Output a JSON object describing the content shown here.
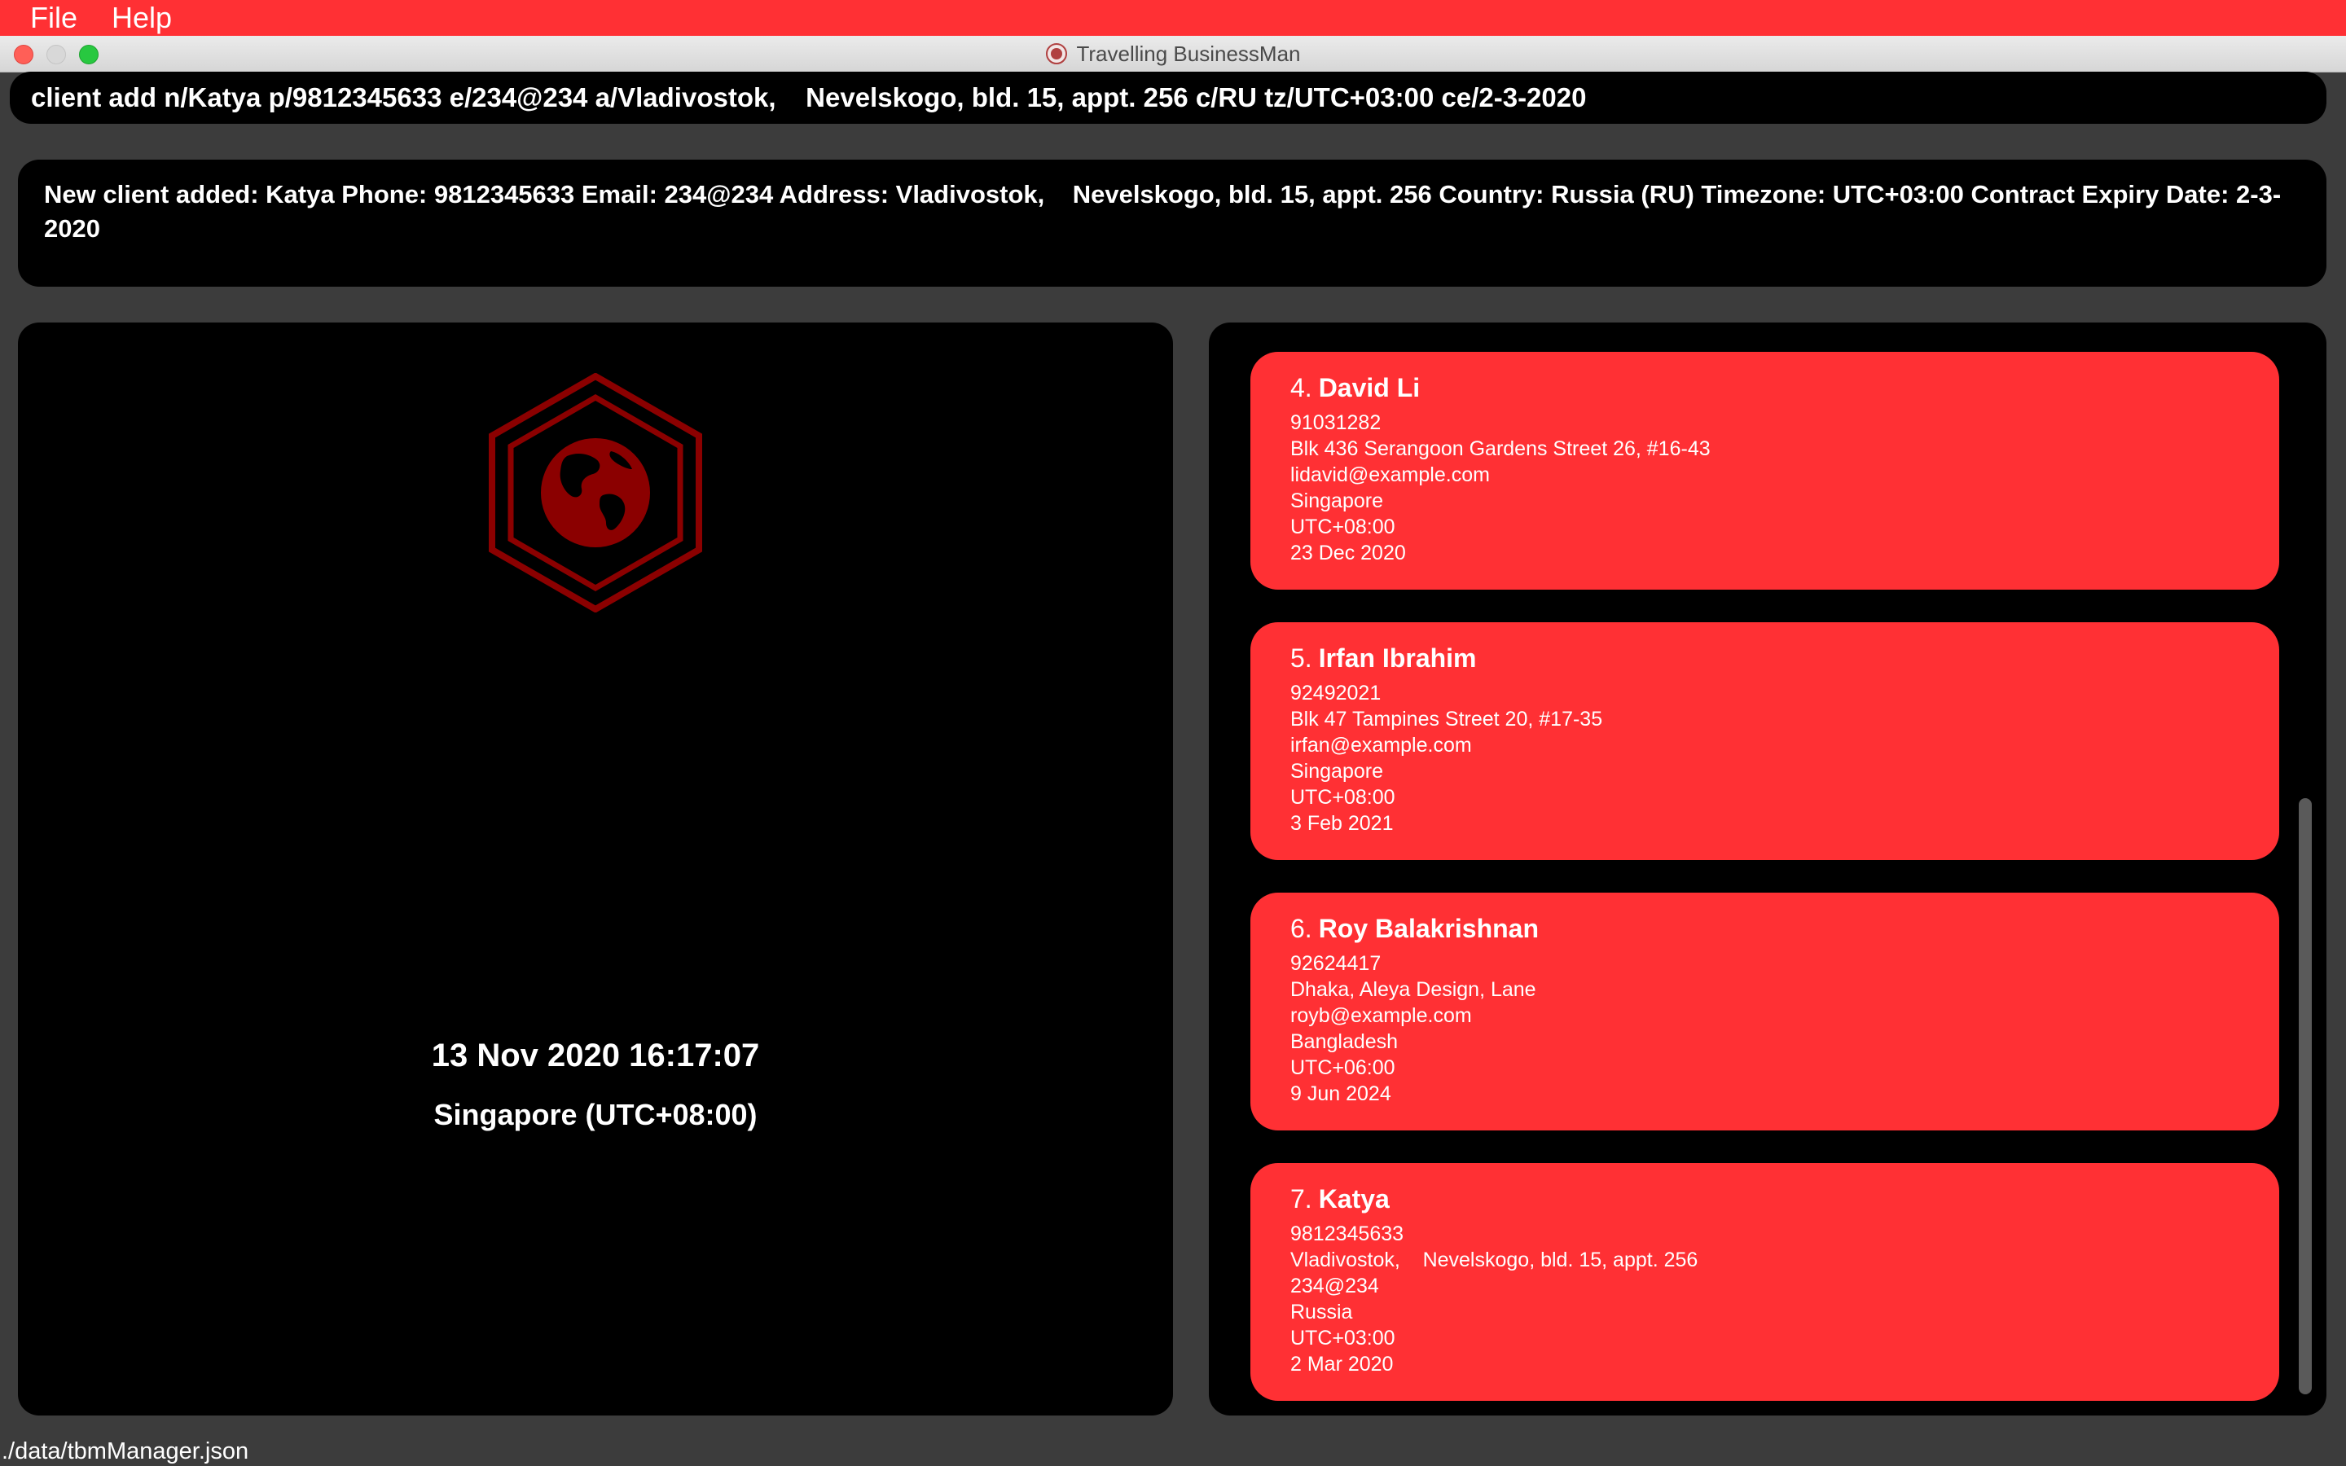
{
  "menu": {
    "file": "File",
    "help": "Help"
  },
  "window": {
    "title": "Travelling BusinessMan"
  },
  "command": {
    "text": "client add n/Katya p/9812345633 e/234@234 a/Vladivostok,    Nevelskogo, bld. 15, appt. 256 c/RU tz/UTC+03:00 ce/2-3-2020"
  },
  "result": {
    "text": "New client added: Katya Phone: 9812345633 Email: 234@234 Address: Vladivostok,    Nevelskogo, bld. 15, appt. 256 Country: Russia (RU) Timezone: UTC+03:00 Contract Expiry Date: 2-3-2020"
  },
  "clock": {
    "datetime": "13 Nov 2020 16:17:07",
    "zone": "Singapore (UTC+08:00)"
  },
  "clients": [
    {
      "index": "4.",
      "name": "David Li",
      "phone": "91031282",
      "address": "Blk 436 Serangoon Gardens Street 26, #16-43",
      "email": "lidavid@example.com",
      "country": "Singapore",
      "timezone": "UTC+08:00",
      "expiry": "23 Dec 2020"
    },
    {
      "index": "5.",
      "name": "Irfan Ibrahim",
      "phone": "92492021",
      "address": "Blk 47 Tampines Street 20, #17-35",
      "email": "irfan@example.com",
      "country": "Singapore",
      "timezone": "UTC+08:00",
      "expiry": "3 Feb 2021"
    },
    {
      "index": "6.",
      "name": "Roy Balakrishnan",
      "phone": "92624417",
      "address": "Dhaka, Aleya Design, Lane",
      "email": "royb@example.com",
      "country": "Bangladesh",
      "timezone": "UTC+06:00",
      "expiry": "9 Jun 2024"
    },
    {
      "index": "7.",
      "name": "Katya",
      "phone": "9812345633",
      "address": "Vladivostok,    Nevelskogo, bld. 15, appt. 256",
      "email": "234@234",
      "country": "Russia",
      "timezone": "UTC+03:00",
      "expiry": "2 Mar 2020"
    }
  ],
  "status": {
    "path": "./data/tbmManager.json"
  },
  "colors": {
    "accent": "#ff3034",
    "panel": "#000000",
    "background": "#3c3c3c",
    "logo": "#8b0000"
  },
  "icons": {
    "logo": "globe-hexagon-icon",
    "title": "globe-icon"
  }
}
